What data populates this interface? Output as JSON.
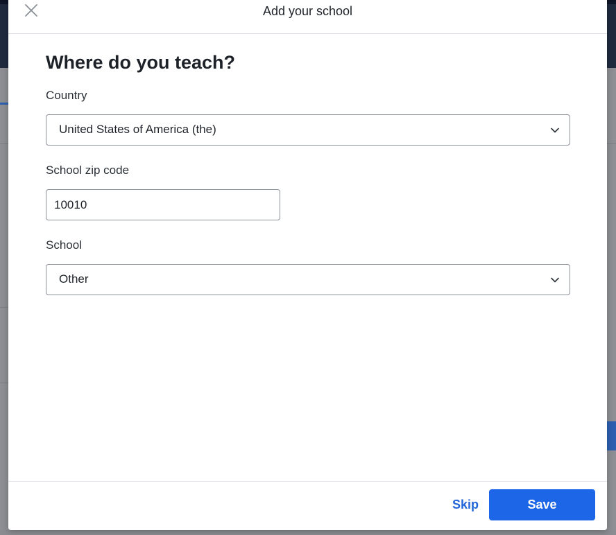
{
  "modal": {
    "title": "Add your school",
    "heading": "Where do you teach?"
  },
  "form": {
    "country": {
      "label": "Country",
      "value": "United States of America (the)"
    },
    "zip": {
      "label": "School zip code",
      "value": "10010"
    },
    "school": {
      "label": "School",
      "value": "Other"
    }
  },
  "footer": {
    "skip_label": "Skip",
    "save_label": "Save"
  },
  "icons": {
    "close": "close-icon",
    "chevron": "chevron-down-icon"
  },
  "colors": {
    "accent": "#1d66e8",
    "link": "#2266d8",
    "backdrop_header": "#1f2a3f"
  }
}
